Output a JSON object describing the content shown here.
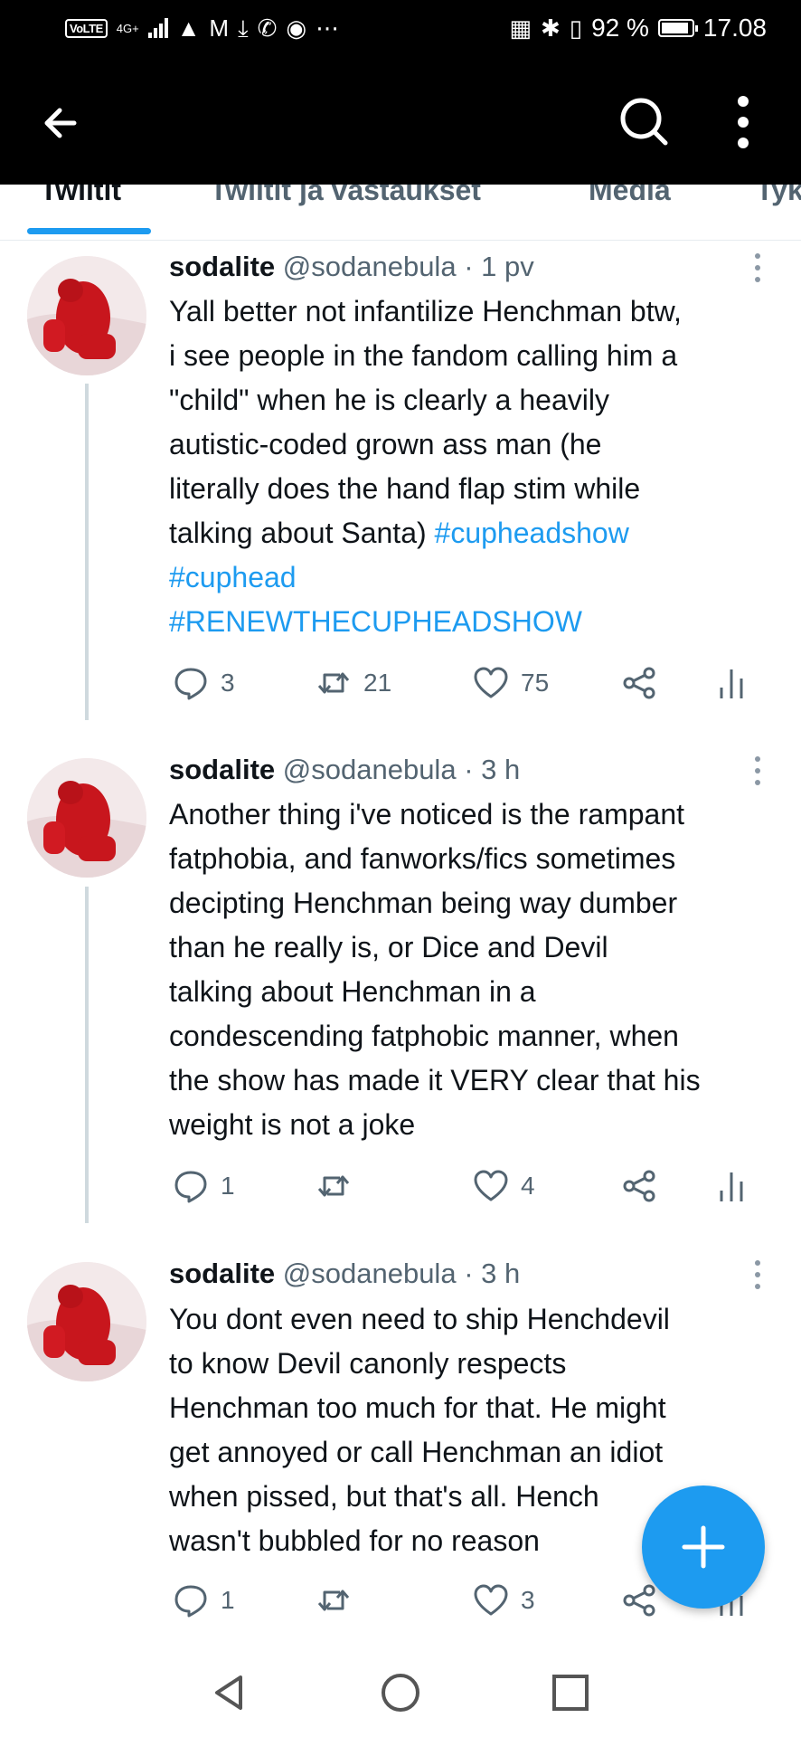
{
  "status_bar": {
    "volte": "VoLTE",
    "network": "4G+",
    "signal_levels": [
      1,
      2,
      3,
      4
    ],
    "icons": [
      "notification-icon",
      "gmail-icon",
      "download-icon",
      "whatsapp-icon",
      "facebook-icon",
      "more-dots-icon"
    ],
    "right_icons": [
      "nfc-icon",
      "bluetooth-icon",
      "vibrate-icon"
    ],
    "battery_text": "92 %",
    "battery_level": 0.92,
    "time": "17.08"
  },
  "appbar": {
    "back_icon": "arrow-left-icon",
    "search_icon": "search-icon",
    "menu_icon": "kebab-menu-icon"
  },
  "tabs": [
    {
      "label": "Twiitit"
    },
    {
      "label": "Twiitit ja vastaukset"
    },
    {
      "label": "Media"
    },
    {
      "label": "Tyk"
    }
  ],
  "accent_color": "#1d9bf0",
  "tweets": [
    {
      "name": "sodalite",
      "handle": "@sodanebula",
      "dot": "·",
      "time": "1 pv",
      "lines": [
        "Yall better not infantilize Henchman btw,",
        "i see people in the fandom calling him a",
        "\"child\" when he is clearly a heavily",
        "autistic-coded grown ass man (he",
        "literally does the hand flap stim while",
        "talking about Santa) "
      ],
      "hashtags": [
        "#cupheadshow",
        "#cuphead",
        "#RENEWTHECUPHEADSHOW"
      ],
      "replies": "3",
      "retweets": "21",
      "likes": "75"
    },
    {
      "name": "sodalite",
      "handle": "@sodanebula",
      "dot": "·",
      "time": "3 h",
      "lines": [
        "Another thing i've noticed is the rampant",
        "fatphobia, and fanworks/fics sometimes",
        "decipting Henchman being way dumber",
        "than he really is, or Dice and Devil",
        "talking about Henchman in a",
        "condescending fatphobic manner, when",
        "the show has made it VERY clear that his",
        "weight is not a joke"
      ],
      "replies": "1",
      "retweets": "",
      "likes": "4"
    },
    {
      "name": "sodalite",
      "handle": "@sodanebula",
      "dot": "·",
      "time": "3 h",
      "lines": [
        "You dont even need to ship Henchdevil",
        "to know Devil canonly respects",
        "Henchman too much for that. He might",
        "get annoyed or call Henchman an idiot",
        "when pissed, but that's all. Hench",
        "wasn't bubbled for no reason"
      ],
      "replies": "1",
      "retweets": "",
      "likes": "3"
    }
  ],
  "fab": {
    "icon": "plus-icon"
  },
  "navbar": {
    "icons": [
      "nav-back-icon",
      "nav-home-icon",
      "nav-recents-icon"
    ]
  }
}
